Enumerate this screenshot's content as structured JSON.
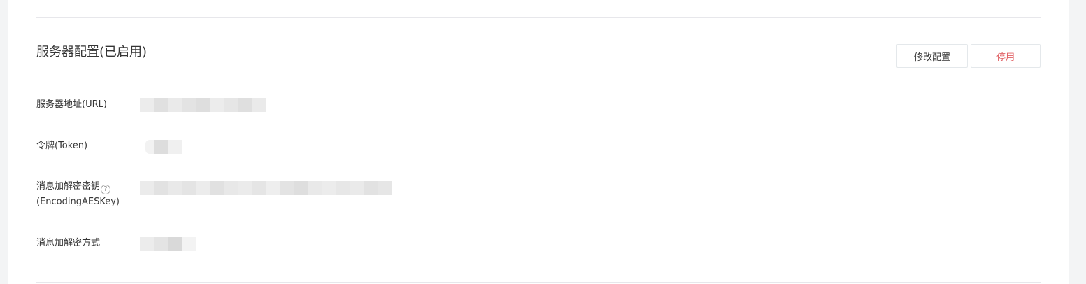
{
  "section": {
    "title": "服务器配置(已启用)",
    "edit_button": "修改配置",
    "disable_button": "停用"
  },
  "fields": {
    "url_label": "服务器地址(URL)",
    "token_label": "令牌(Token)",
    "aes_label_line1": "消息加解密密钥",
    "aes_label_line2": "(EncodingAESKey)",
    "mode_label": "消息加解密方式"
  },
  "icons": {
    "help": "?"
  },
  "colors": {
    "danger": "#e15f63",
    "redacted_light": "#efefef",
    "redacted_dark": "#e2e2e2"
  }
}
